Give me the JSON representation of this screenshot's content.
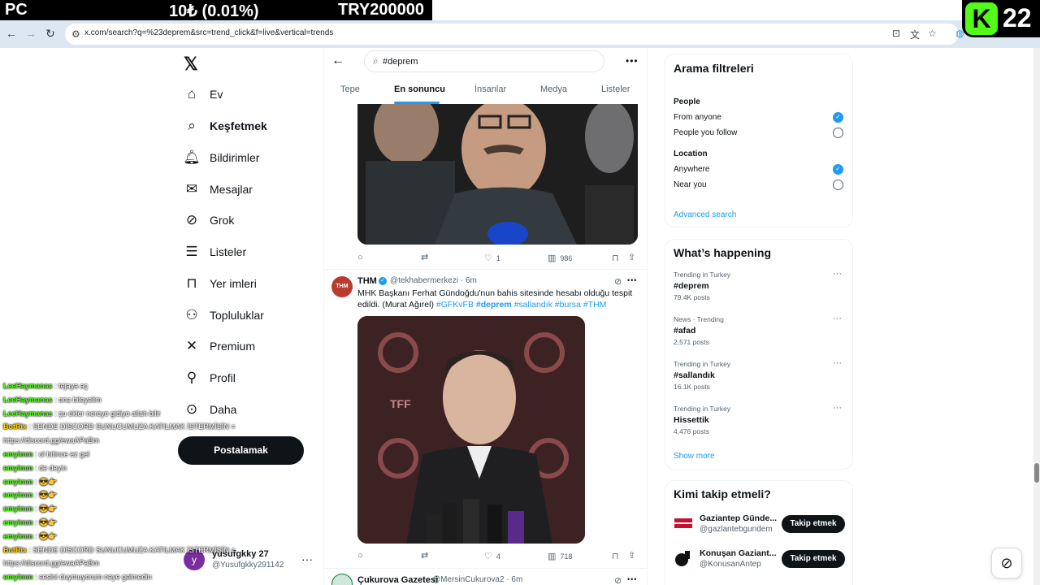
{
  "stream_overlay": {
    "left": "PC",
    "middle": "10₺ (0.01%)",
    "right": "TRY200000",
    "logo_letter": "K",
    "logo_number": "22"
  },
  "browser": {
    "url": "x.com/search?q=%23deprem&src=trend_click&f=live&vertical=trends"
  },
  "sidebar": {
    "items": [
      {
        "label": "Ev",
        "icon": "home-icon"
      },
      {
        "label": "Keşfetmek",
        "icon": "search-icon",
        "active": true
      },
      {
        "label": "Bildirimler",
        "icon": "bell-icon"
      },
      {
        "label": "Mesajlar",
        "icon": "envelope-icon"
      },
      {
        "label": "Grok",
        "icon": "grok-icon"
      },
      {
        "label": "Listeler",
        "icon": "list-icon"
      },
      {
        "label": "Yer imleri",
        "icon": "bookmark-icon"
      },
      {
        "label": "Topluluklar",
        "icon": "communities-icon"
      },
      {
        "label": "Premium",
        "icon": "x-icon"
      },
      {
        "label": "Profil",
        "icon": "person-icon"
      },
      {
        "label": "Daha",
        "icon": "more-circle-icon"
      }
    ],
    "post_button": "Postalamak",
    "account": {
      "name": "yusufgkky 27",
      "handle": "@Yusufgkky291142",
      "initial": "y"
    }
  },
  "chat": [
    {
      "user": "LeeHaymanas",
      "msg": ": tejaya aç"
    },
    {
      "user": "LeeHaymanas",
      "msg": ": ona bileyelim"
    },
    {
      "user": "LeeHaymanas",
      "msg": ": şu ekler nereye gidiyo allah bilir"
    },
    {
      "user": "BotRix",
      "msg": ": SENDE DİSCORD SUNUCUMUZA KATILMAK İSTERMİSİN ="
    },
    {
      "user": "",
      "msg": "https://discord.gg/ewaAPaBm"
    },
    {
      "user": "emyimm",
      "msg": ": ol bitince ez gel"
    },
    {
      "user": "emyimm",
      "msg": ": de deyin"
    },
    {
      "user": "emyimm",
      "msg": ": 😎👉"
    },
    {
      "user": "emyimm",
      "msg": ": 😎👉"
    },
    {
      "user": "emyimm",
      "msg": ": 😎👉"
    },
    {
      "user": "emyimm",
      "msg": ": 😎👉"
    },
    {
      "user": "emyimm",
      "msg": ": 😎👉"
    },
    {
      "user": "BotRix",
      "msg": ": SENDE DİSCORD SUNUCUMUZA KATILMAK İSTERMİSİN ="
    },
    {
      "user": "",
      "msg": "https://discord.gg/ewaAPaBm"
    },
    {
      "user": "emyimm",
      "msg": ": seslni duymuyorum neye gelmedin"
    }
  ],
  "search": {
    "value": "#deprem",
    "tabs": [
      "Tepe",
      "En sonuncu",
      "İnsanlar",
      "Medya",
      "Listeler"
    ],
    "active_tab": "En sonuncu"
  },
  "tweet1": {
    "replies": "",
    "retweets": "",
    "likes": "1",
    "views": "986"
  },
  "tweet2": {
    "avatar_text": "THM",
    "name": "THM",
    "handle": "@tekhabermerkezi · 6m",
    "text_plain": "MHK Başkanı Ferhat Gündoğdu'nun bahis sitesinde hesabı olduğu tespit edildi. (Murat Ağırel) ",
    "tags": [
      "#GFKvFB",
      "#deprem",
      "#sallandık",
      "#bursa",
      "#THM"
    ],
    "image_text": "TFF",
    "likes": "4",
    "views": "718"
  },
  "tweet3": {
    "name": "Çukurova Gazetesi",
    "handle": "@MersinCukurova2 · 6m"
  },
  "filters": {
    "title": "Arama filtreleri",
    "people_heading": "People",
    "people_options": [
      "From anyone",
      "People you follow"
    ],
    "location_heading": "Location",
    "location_options": [
      "Anywhere",
      "Near you"
    ],
    "advanced": "Advanced search"
  },
  "happening": {
    "title": "What’s happening",
    "trends": [
      {
        "context": "Trending in Turkey",
        "name": "#deprem",
        "count": "79.4K posts"
      },
      {
        "context": "News · Trending",
        "name": "#afad",
        "count": "2,571 posts"
      },
      {
        "context": "Trending in Turkey",
        "name": "#sallandık",
        "count": "16.1K posts"
      },
      {
        "context": "Trending in Turkey",
        "name": "Hissettik",
        "count": "4,476 posts"
      }
    ],
    "show_more": "Show more"
  },
  "who_to_follow": {
    "title": "Kimi takip etmeli?",
    "accounts": [
      {
        "name": "Gaziantep Günde...",
        "handle": "@gazlantebgundem",
        "button": "Takip etmek"
      },
      {
        "name": "Konuşan Gaziant...",
        "handle": "@KonusanAntep",
        "button": "Takip etmek"
      }
    ]
  },
  "colors": {
    "accent": "#1d9bf0",
    "text": "#0f1419",
    "muted": "#536471",
    "kick_green": "#53fc18"
  }
}
